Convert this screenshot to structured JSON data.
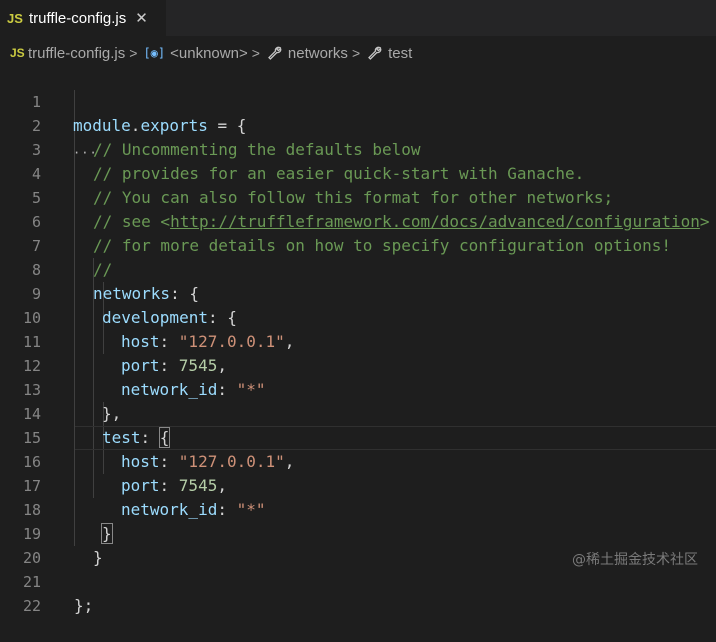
{
  "tab": {
    "badge": "JS",
    "title": "truffle-config.js",
    "close": "✕"
  },
  "breadcrumb": {
    "badge": "JS",
    "file": "truffle-config.js",
    "symbol": "<unknown>",
    "networks": "networks",
    "test": "test",
    "separator": ">"
  },
  "code": {
    "l1a": "module",
    "l1b": ".",
    "l1c": "exports",
    "l1d": " = {",
    "l2": "// Uncommenting the defaults below",
    "l3": "// provides for an easier quick-start with Ganache.",
    "l4": "// You can also follow this format for other networks;",
    "l5a": "// see <",
    "l5b": "http://truffleframework.com/docs/advanced/configuration",
    "l5c": ">",
    "l6": "// for more details on how to specify configuration options!",
    "l7": "//",
    "l8k": "networks",
    "l8r": ": {",
    "l9k": "development",
    "l9r": ": {",
    "l10k": "host",
    "l10s": "\"127.0.0.1\"",
    "l11k": "port",
    "l11n": "7545",
    "l12k": "network_id",
    "l12s": "\"*\"",
    "l13": "},",
    "l14k": "test",
    "l14c": ": ",
    "l14b": "{",
    "l15k": "host",
    "l15s": "\"127.0.0.1\"",
    "l16k": "port",
    "l16n": "7545",
    "l17k": "network_id",
    "l17s": "\"*\"",
    "l18": "}",
    "l19": "}",
    "l21": "};",
    "colon": ": ",
    "comma": ","
  },
  "line_numbers": [
    "1",
    "2",
    "3",
    "4",
    "5",
    "6",
    "7",
    "8",
    "9",
    "10",
    "11",
    "12",
    "13",
    "14",
    "15",
    "16",
    "17",
    "18",
    "19",
    "20",
    "21",
    "22"
  ],
  "watermark": "@稀土掘金技术社区",
  "colors": {
    "comment": "#6a9955",
    "string": "#ce9178",
    "number": "#b5cea8",
    "property": "#9cdcfe",
    "background": "#1e1e1e"
  }
}
